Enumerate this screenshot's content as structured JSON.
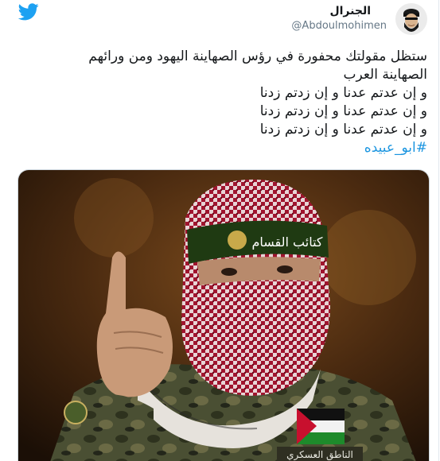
{
  "tweet": {
    "display_name": "الجنرال",
    "handle": "@Abdoulmohimen",
    "lines": [
      "ستظل مقولتك محفورة في رؤس الصهاينة اليهود ومن ورائهم",
      "الصهاينة العرب",
      "و إن عدتم عدنا و إن زدتم زدنا",
      "و إن عدتم عدنا و إن زدتم زدنا",
      "و إن عدتم عدنا و إن زدتم زدنا"
    ],
    "hashtag": "#ابو_عبيده",
    "photo": {
      "headband_text": "كتائب القسام",
      "badge_text": "الناطق العسكري"
    }
  },
  "colors": {
    "twitter_blue": "#1da1f2",
    "link_blue": "#1b95e0",
    "headband_red": "#8d1227"
  }
}
